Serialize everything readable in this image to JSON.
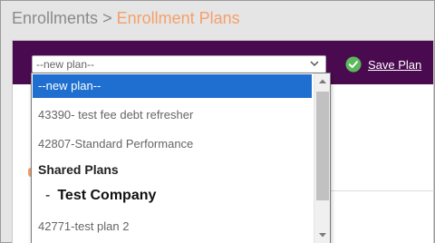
{
  "breadcrumb": {
    "root": "Enrollments",
    "separator": ">",
    "current": "Enrollment Plans"
  },
  "toolbar": {
    "plan_select_value": "--new plan--",
    "save_label": "Save Plan"
  },
  "dropdown": {
    "options": [
      {
        "label": "--new plan--",
        "selected": true
      },
      {
        "label": "43390- test fee debt refresher"
      },
      {
        "label": "42807-Standard Performance"
      }
    ],
    "group_label": "Shared Plans",
    "company_dash": "-",
    "company_label": "Test Company",
    "trailing_option": "42771-test plan 2"
  },
  "icons": {
    "save": "check-circle-icon",
    "select": "chevron-down-icon",
    "scroll_up": "arrow-up-icon",
    "scroll_down": "arrow-down-icon"
  },
  "colors": {
    "toolbar_bg": "#4a0a4f",
    "accent_orange": "#f4a06b",
    "selected_option": "#1e6fd0",
    "check_green": "#5cb85c"
  }
}
